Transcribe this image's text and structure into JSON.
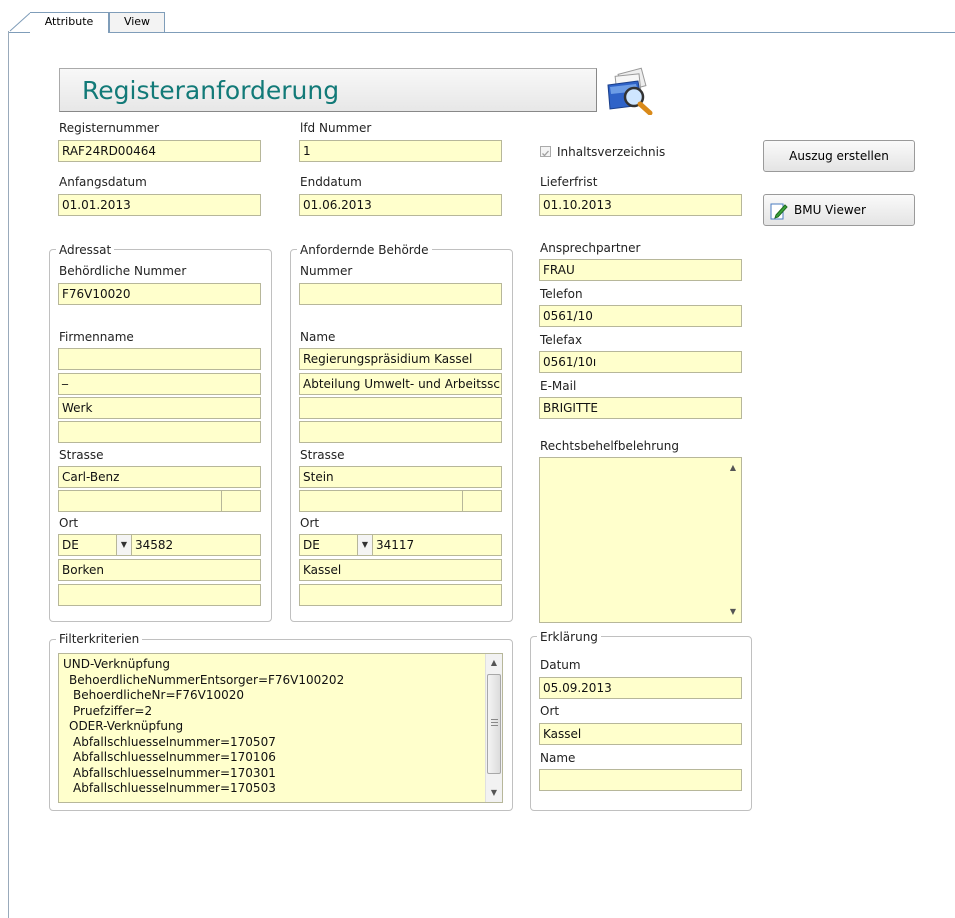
{
  "tabs": [
    {
      "label": "Attribute"
    },
    {
      "label": "View"
    }
  ],
  "title": "Registeranforderung",
  "title_icon": "search-folder-icon",
  "fields": {
    "registernummer": {
      "label": "Registernummer",
      "value": "RAF24RD00464"
    },
    "lfd_nummer": {
      "label": "lfd Nummer",
      "value": "1"
    },
    "inhaltsverzeichnis": {
      "label": "Inhaltsverzeichnis",
      "checked": true
    },
    "anfangsdatum": {
      "label": "Anfangsdatum",
      "value": "01.01.2013"
    },
    "enddatum": {
      "label": "Enddatum",
      "value": "01.06.2013"
    },
    "lieferfrist": {
      "label": "Lieferfrist",
      "value": "01.10.2013"
    }
  },
  "buttons": {
    "auszug": "Auszug erstellen",
    "bmu": "BMU Viewer"
  },
  "adressat": {
    "legend": "Adressat",
    "nummer_label": "Behördliche Nummer",
    "nummer": "F76V10020",
    "firmenname_label": "Firmenname",
    "firma1": "",
    "firma2": "_",
    "firma3": "Werk",
    "firma4": "",
    "strasse_label": "Strasse",
    "strasse": "Carl-Benz",
    "strasse2": "",
    "hausnr": "",
    "ort_label": "Ort",
    "land": "DE",
    "plz": "34582",
    "ort": "Borken",
    "ort2": ""
  },
  "behoerde": {
    "legend": "Anfordernde Behörde",
    "nummer_label": "Nummer",
    "nummer": "",
    "name_label": "Name",
    "name1": "Regierungspräsidium Kassel",
    "name2": "Abteilung Umwelt- und Arbeitssch",
    "name3": "",
    "name4": "",
    "strasse_label": "Strasse",
    "strasse": "Stein",
    "strasse2": "",
    "hausnr": "",
    "ort_label": "Ort",
    "land": "DE",
    "plz": "34117",
    "ort": "Kassel",
    "ort2": ""
  },
  "kontakt": {
    "ansprechpartner_label": "Ansprechpartner",
    "ansprechpartner": "FRAU",
    "telefon_label": "Telefon",
    "telefon": "0561/10",
    "telefax_label": "Telefax",
    "telefax": "0561/10ı",
    "email_label": "E-Mail",
    "email": "BRIGITTE",
    "rechtsbehelf_label": "Rechtsbehelfbelehrung"
  },
  "filter": {
    "legend": "Filterkriterien",
    "lines": [
      "UND-Verknüpfung",
      " BehoerdlicheNummerEntsorger=F76V100202",
      "  BehoerdlicheNr=F76V10020",
      "  Pruefziffer=2",
      " ODER-Verknüpfung",
      "  Abfallschluesselnummer=170507",
      "  Abfallschluesselnummer=170106",
      "  Abfallschluesselnummer=170301",
      "  Abfallschluesselnummer=170503"
    ]
  },
  "erklaerung": {
    "legend": "Erklärung",
    "datum_label": "Datum",
    "datum": "05.09.2013",
    "ort_label": "Ort",
    "ort": "Kassel",
    "name_label": "Name",
    "name": ""
  },
  "colors": {
    "field_bg": "#ffffcc",
    "title_text": "#127a78"
  }
}
